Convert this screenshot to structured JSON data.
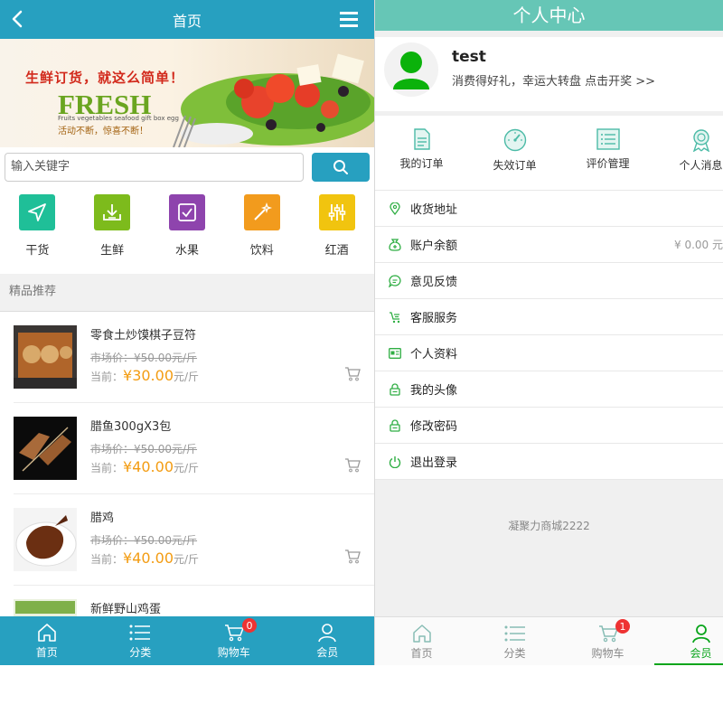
{
  "left": {
    "header": {
      "title": "首页"
    },
    "banner": {
      "slogan": "生鲜订货，就这么简单！",
      "brand": "FRESH",
      "subtitle": "Fruits vegetables seafood gift box egg",
      "tagline": "活动不断，惊喜不断！"
    },
    "search": {
      "placeholder": "输入关键字"
    },
    "categories": [
      {
        "label": "干货",
        "color": "#1fbf98",
        "icon": "send-icon"
      },
      {
        "label": "生鲜",
        "color": "#7dbb1c",
        "icon": "download-box-icon"
      },
      {
        "label": "水果",
        "color": "#8e44ad",
        "icon": "checkbox-icon"
      },
      {
        "label": "饮料",
        "color": "#f29b1d",
        "icon": "magic-wand-icon"
      },
      {
        "label": "红酒",
        "color": "#f1c40f",
        "icon": "sliders-icon"
      }
    ],
    "section_title": "精品推荐",
    "products": [
      {
        "name": "零食土炒馍棋子豆符",
        "market": "市场价：¥50.00元/斤",
        "current_label": "当前：",
        "price": "¥30.00",
        "unit": "元/斤"
      },
      {
        "name": "腊鱼300gX3包",
        "market": "市场价：¥50.00元/斤",
        "current_label": "当前：",
        "price": "¥40.00",
        "unit": "元/斤"
      },
      {
        "name": "腊鸡",
        "market": "市场价：¥50.00元/斤",
        "current_label": "当前：",
        "price": "¥40.00",
        "unit": "元/斤"
      },
      {
        "name": "新鲜野山鸡蛋",
        "market": "",
        "current_label": "",
        "price": "",
        "unit": ""
      }
    ],
    "footer": [
      {
        "label": "首页",
        "icon": "home-icon"
      },
      {
        "label": "分类",
        "icon": "list-icon"
      },
      {
        "label": "购物车",
        "icon": "cart-icon",
        "badge": "0"
      },
      {
        "label": "会员",
        "icon": "user-icon"
      }
    ]
  },
  "right": {
    "header": {
      "title": "个人中心"
    },
    "profile": {
      "username": "test",
      "promo": "消费得好礼，幸运大转盘 点击开奖 >>"
    },
    "quick": [
      {
        "label": "我的订单",
        "icon": "order-doc-icon"
      },
      {
        "label": "失效订单",
        "icon": "gauge-icon"
      },
      {
        "label": "评价管理",
        "icon": "list-doc-icon"
      },
      {
        "label": "个人消息",
        "icon": "award-icon"
      }
    ],
    "menu": [
      {
        "label": "收货地址",
        "icon": "location-icon",
        "value": ""
      },
      {
        "label": "账户余额",
        "icon": "money-bag-icon",
        "value": "¥ 0.00 元"
      },
      {
        "label": "意见反馈",
        "icon": "chat-icon",
        "value": ""
      },
      {
        "label": "客服服务",
        "icon": "service-icon",
        "value": ""
      },
      {
        "label": "个人资料",
        "icon": "id-card-icon",
        "value": ""
      },
      {
        "label": "我的头像",
        "icon": "lock-icon",
        "value": ""
      },
      {
        "label": "修改密码",
        "icon": "lock-icon",
        "value": ""
      },
      {
        "label": "退出登录",
        "icon": "power-icon",
        "value": ""
      }
    ],
    "copyright": "凝聚力商城2222",
    "footer": [
      {
        "label": "首页",
        "icon": "home-icon"
      },
      {
        "label": "分类",
        "icon": "list-icon"
      },
      {
        "label": "购物车",
        "icon": "cart-icon",
        "badge": "1"
      },
      {
        "label": "会员",
        "icon": "user-icon"
      }
    ],
    "active_color": "#09a51b"
  },
  "theme": {
    "primary": "#27a0c0",
    "member_header": "#66c6b6",
    "price": "#f39c12"
  }
}
